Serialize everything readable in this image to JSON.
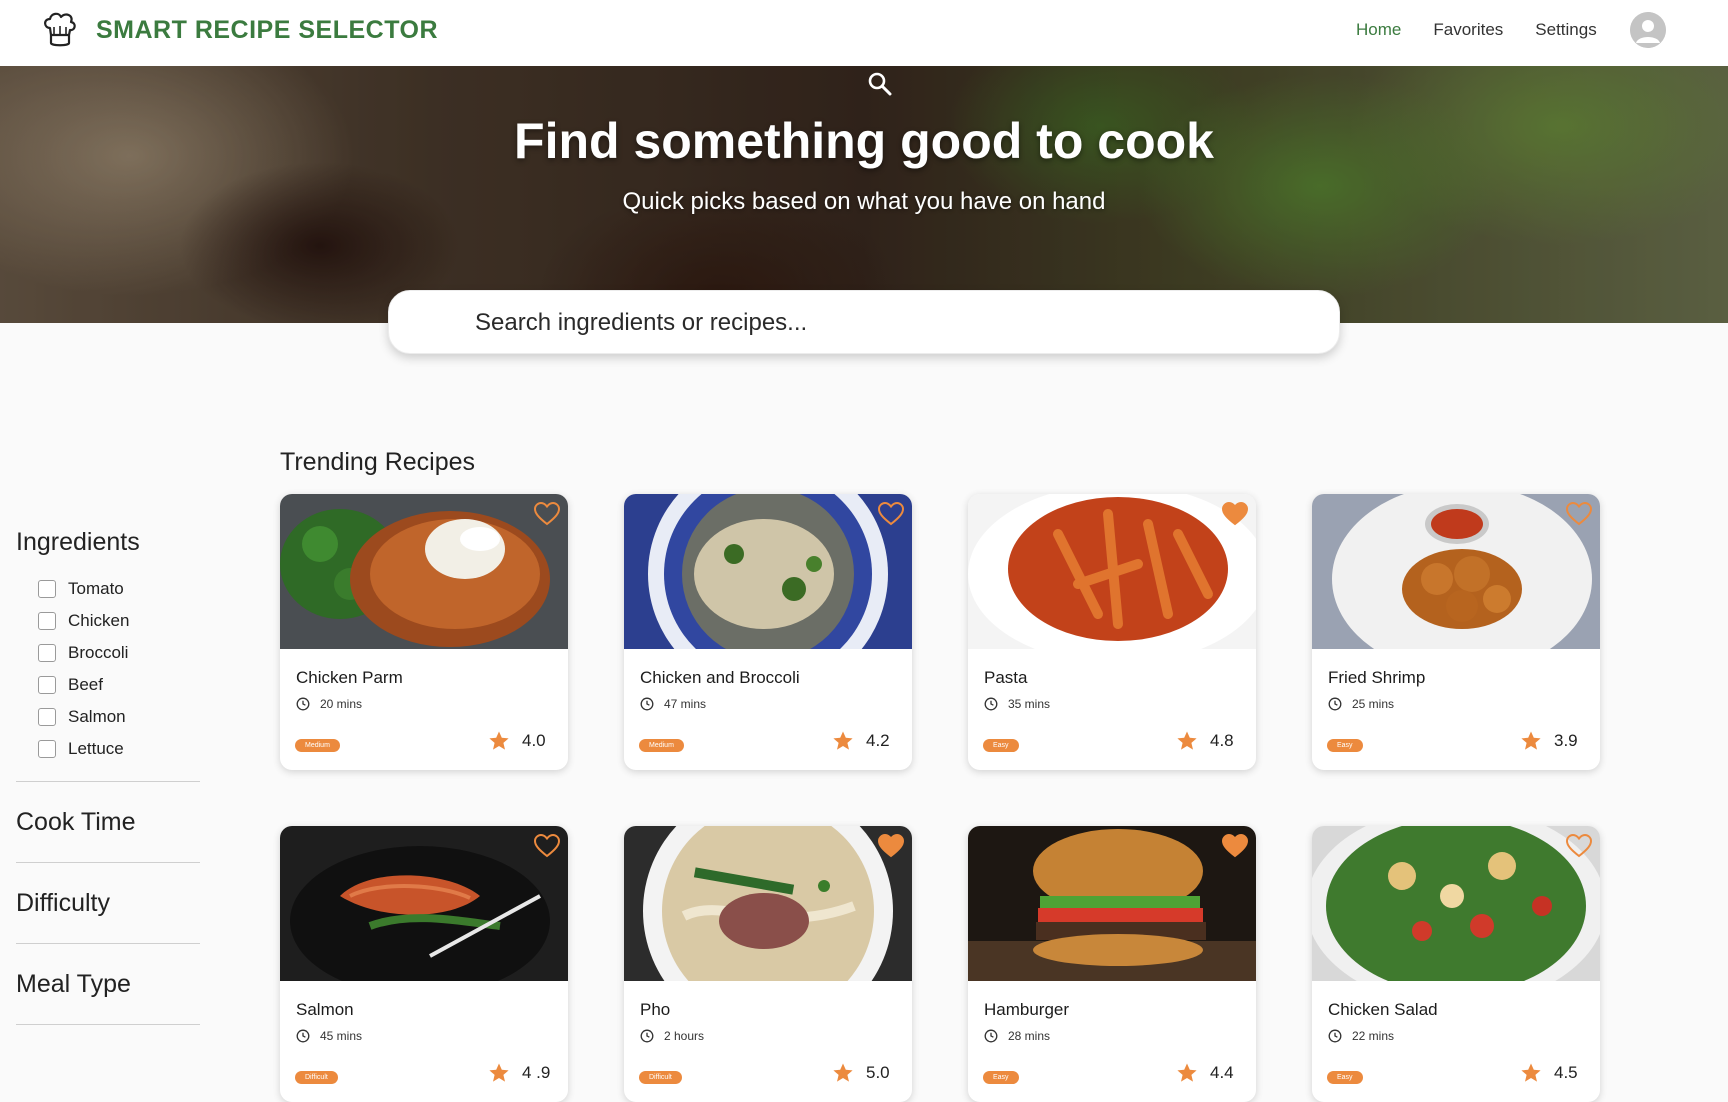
{
  "header": {
    "title": "SMART RECIPE SELECTOR",
    "nav": [
      {
        "label": "Home",
        "active": true
      },
      {
        "label": "Favorites",
        "active": false
      },
      {
        "label": "Settings",
        "active": false
      }
    ]
  },
  "hero": {
    "title": "Find something good to cook",
    "subtitle": "Quick picks based on what you have on hand",
    "search_placeholder": "Search ingredients or recipes..."
  },
  "sidebar": {
    "ingredients_heading": "Ingredients",
    "ingredients": [
      "Tomato",
      "Chicken",
      "Broccoli",
      "Beef",
      "Salmon",
      "Lettuce"
    ],
    "sections": [
      "Cook Time",
      "Difficulty",
      "Meal Type"
    ]
  },
  "main": {
    "section_title": "Trending Recipes",
    "recipes": [
      {
        "name": "Chicken Parm",
        "time": "20 mins",
        "difficulty": "Medium",
        "rating": "4.0",
        "favorite": false,
        "image": "chicken-parm"
      },
      {
        "name": "Chicken and Broccoli",
        "time": "47 mins",
        "difficulty": "Medium",
        "rating": "4.2",
        "favorite": false,
        "image": "chicken-broccoli"
      },
      {
        "name": "Pasta",
        "time": "35 mins",
        "difficulty": "Easy",
        "rating": "4.8",
        "favorite": true,
        "image": "pasta"
      },
      {
        "name": "Fried Shrimp",
        "time": "25 mins",
        "difficulty": "Easy",
        "rating": "3.9",
        "favorite": false,
        "image": "fried-shrimp"
      },
      {
        "name": "Salmon",
        "time": "45 mins",
        "difficulty": "Difficult",
        "rating": "4 .9",
        "favorite": false,
        "image": "salmon"
      },
      {
        "name": "Pho",
        "time": "2 hours",
        "difficulty": "Difficult",
        "rating": "5.0",
        "favorite": true,
        "image": "pho"
      },
      {
        "name": "Hamburger",
        "time": "28 mins",
        "difficulty": "Easy",
        "rating": "4.4",
        "favorite": true,
        "image": "hamburger"
      },
      {
        "name": "Chicken Salad",
        "time": "22 mins",
        "difficulty": "Easy",
        "rating": "4.5",
        "favorite": false,
        "image": "chicken-salad"
      }
    ]
  },
  "colors": {
    "brand_green": "#3b7b3f",
    "accent_orange": "#ec8a3e"
  }
}
